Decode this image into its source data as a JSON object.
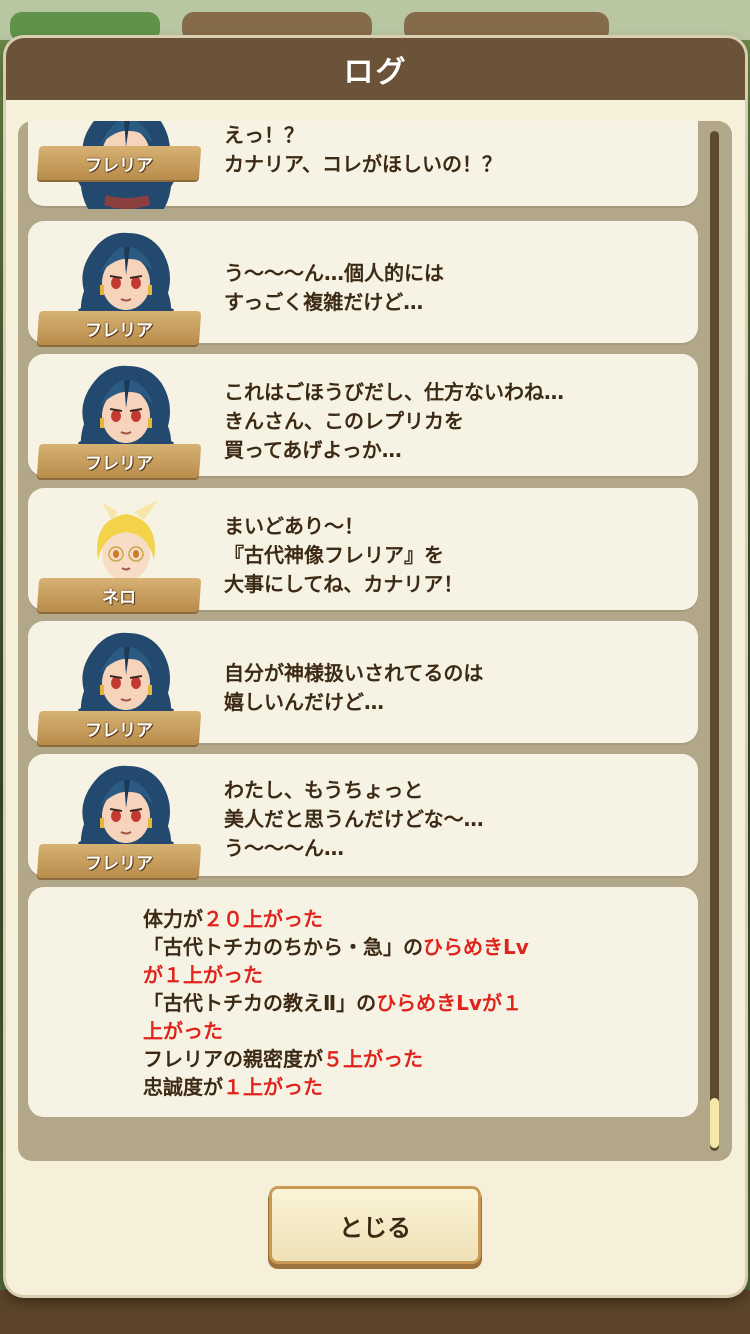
{
  "dialog": {
    "title": "ログ",
    "close_label": "とじる"
  },
  "entries": [
    {
      "speaker": "フレリア",
      "portrait": "freria-portrait",
      "text": "えっ！？\nカナリア、コレがほしいの！？"
    },
    {
      "speaker": "フレリア",
      "portrait": "freria-portrait",
      "text": "う〜〜〜ん…個人的には\nすっごく複雑だけど…"
    },
    {
      "speaker": "フレリア",
      "portrait": "freria-portrait",
      "text": "これはごほうびだし、仕方ないわね…\nきんさん、このレプリカを\n買ってあげよっか…"
    },
    {
      "speaker": "ネロ",
      "portrait": "nero-portrait",
      "text": "まいどあり〜！\n『古代神像フレリア』を\n大事にしてね、カナリア！"
    },
    {
      "speaker": "フレリア",
      "portrait": "freria-portrait",
      "text": "自分が神様扱いされてるのは\n嬉しいんだけど…"
    },
    {
      "speaker": "フレリア",
      "portrait": "freria-portrait",
      "text": "わたし、もうちょっと\n美人だと思うんだけどな〜…\nう〜〜〜ん…"
    }
  ],
  "results": [
    [
      {
        "t": "体力が",
        "hl": false
      },
      {
        "t": "２０上がった",
        "hl": true
      }
    ],
    [
      {
        "t": "「古代トチカのちから・急」の",
        "hl": false
      },
      {
        "t": "ひらめきLv",
        "hl": true
      }
    ],
    [
      {
        "t": "が１上がった",
        "hl": true
      }
    ],
    [
      {
        "t": "「古代トチカの教えⅡ」の",
        "hl": false
      },
      {
        "t": "ひらめきLvが１",
        "hl": true
      }
    ],
    [
      {
        "t": "上がった",
        "hl": true
      }
    ],
    [
      {
        "t": "フレリアの親密度が",
        "hl": false
      },
      {
        "t": "５上がった",
        "hl": true
      }
    ],
    [
      {
        "t": "忠誠度が",
        "hl": false
      },
      {
        "t": "１上がった",
        "hl": true
      }
    ]
  ],
  "colors": {
    "header": "#6b5339",
    "highlight": "#e0241c",
    "text": "#3c2a14",
    "panel": "#b3a78a"
  }
}
